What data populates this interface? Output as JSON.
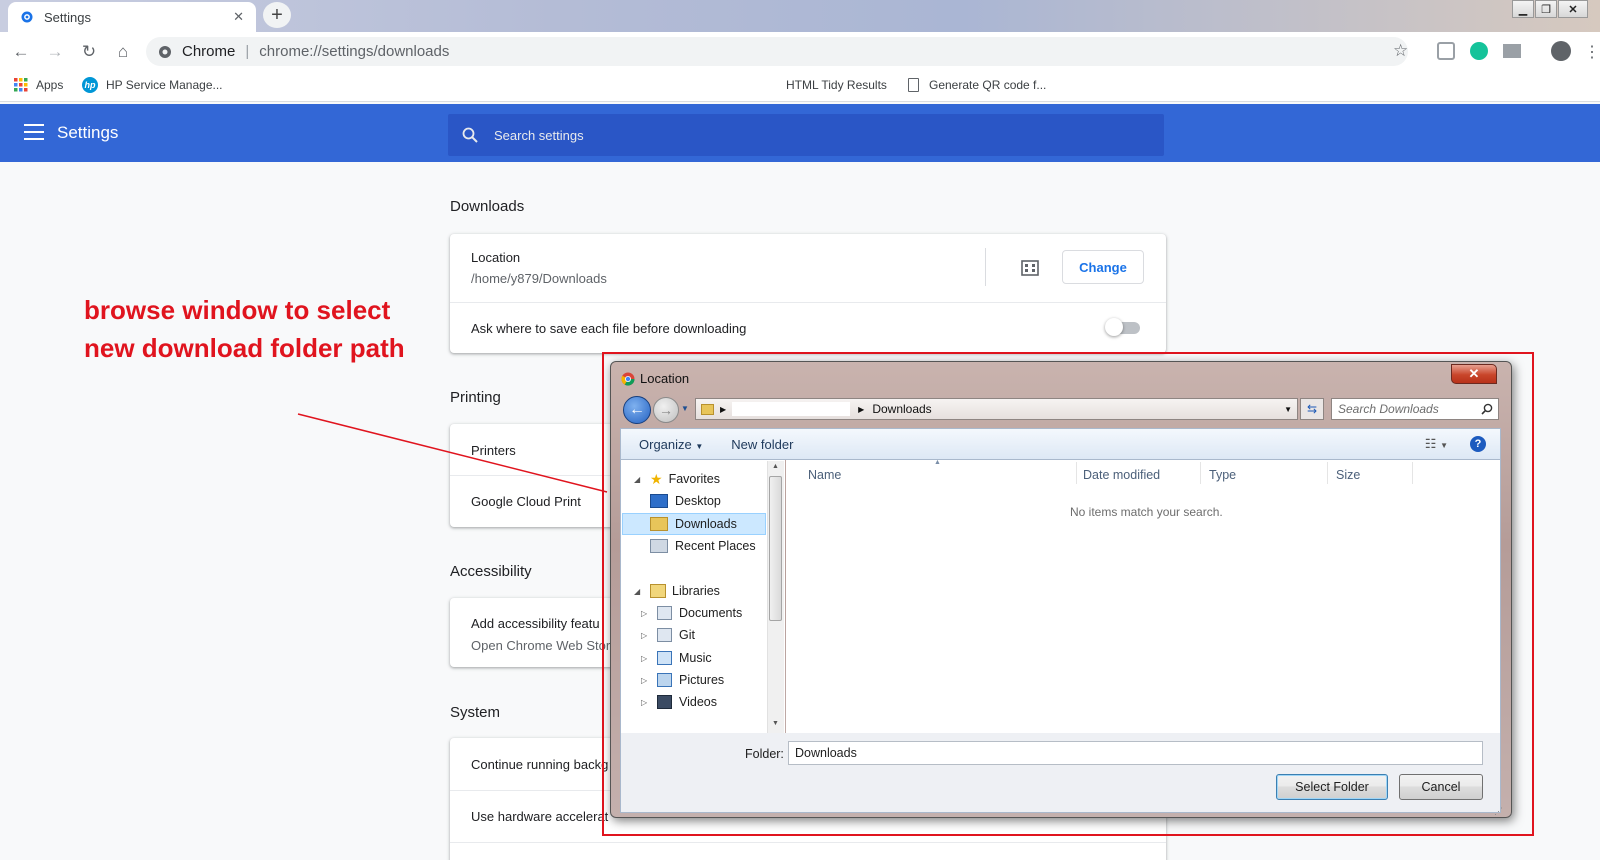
{
  "browser": {
    "tab": {
      "title": "Settings"
    },
    "omnibox": {
      "origin": "Chrome",
      "url": "chrome://settings/downloads"
    },
    "bookmarks": {
      "apps": "Apps",
      "items": [
        "HP Service Manage...",
        "HTML Tidy Results",
        "Generate QR code f..."
      ]
    }
  },
  "settings": {
    "header_title": "Settings",
    "search_placeholder": "Search settings",
    "downloads": {
      "title": "Downloads",
      "location_label": "Location",
      "location_path": "/home/y879/Downloads",
      "change_label": "Change",
      "ask_label": "Ask where to save each file before downloading",
      "ask_enabled": false
    },
    "printing": {
      "title": "Printing",
      "rows": [
        "Printers",
        "Google Cloud Print"
      ]
    },
    "accessibility": {
      "title": "Accessibility",
      "row_title": "Add accessibility featu",
      "row_sub": "Open Chrome Web Stor"
    },
    "system": {
      "title": "System",
      "rows": [
        "Continue running backg",
        "Use hardware accelerat"
      ]
    }
  },
  "annotation": {
    "text": "browse window to select new download folder path",
    "color": "#e0141e"
  },
  "dialog": {
    "title": "Location",
    "close": "✕",
    "breadcrumb_current": "Downloads",
    "search_placeholder": "Search Downloads",
    "organize": "Organize",
    "new_folder": "New folder",
    "help": "?",
    "tree": {
      "favorites": "Favorites",
      "favorites_items": [
        "Desktop",
        "Downloads",
        "Recent Places"
      ],
      "selected": "Downloads",
      "libraries": "Libraries",
      "library_items": [
        "Documents",
        "Git",
        "Music",
        "Pictures",
        "Videos"
      ]
    },
    "columns": [
      "Name",
      "Date modified",
      "Type",
      "Size"
    ],
    "empty_message": "No items match your search.",
    "folder_label": "Folder:",
    "folder_value": "Downloads",
    "select_button": "Select Folder",
    "cancel_button": "Cancel"
  },
  "colors": {
    "header_blue": "#3367d6",
    "accent_blue": "#1a73e8",
    "annotation_red": "#e0141e"
  }
}
